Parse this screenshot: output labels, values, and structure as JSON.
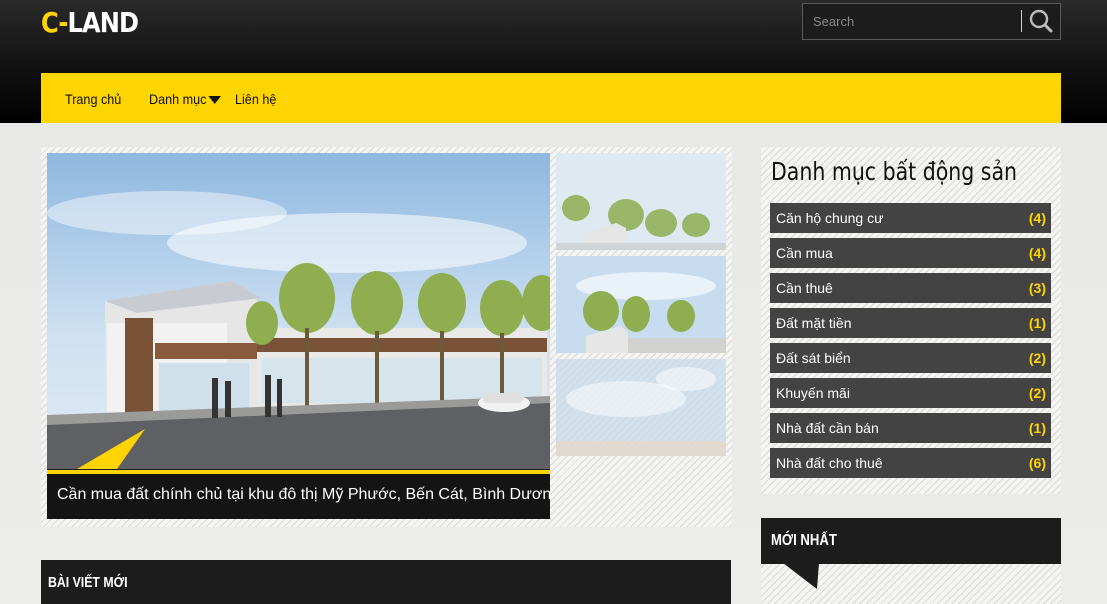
{
  "header": {
    "logo_accent": "C-",
    "logo_main": "LAND",
    "search_placeholder": "Search"
  },
  "nav": {
    "items": [
      {
        "label": "Trang chủ"
      },
      {
        "label": "Danh mục"
      },
      {
        "label": "Liên hệ"
      }
    ]
  },
  "slider": {
    "caption": "Cần mua đất chính chủ tại khu đô thị Mỹ Phước, Bến Cát, Bình Dương"
  },
  "sections": {
    "recent_posts": "BÀI VIẾT MỚI",
    "latest": "MỚI NHẤT"
  },
  "categories": {
    "title": "Danh mục bất động sản",
    "items": [
      {
        "label": "Căn hộ chung cư",
        "count": "(4)"
      },
      {
        "label": "Cần mua",
        "count": "(4)"
      },
      {
        "label": "Cần thuê",
        "count": "(3)"
      },
      {
        "label": "Đất mặt tiền",
        "count": "(1)"
      },
      {
        "label": "Đất sát biển",
        "count": "(2)"
      },
      {
        "label": "Khuyến mãi",
        "count": "(2)"
      },
      {
        "label": "Nhà đất cần bán",
        "count": "(1)"
      },
      {
        "label": "Nhà đất cho thuê",
        "count": "(6)"
      }
    ]
  },
  "colors": {
    "accent": "#ffd400",
    "dark": "#1c1c1c",
    "category_bg": "#434343"
  },
  "icons": {
    "search": "search-icon",
    "dropdown": "caret-down-icon"
  }
}
